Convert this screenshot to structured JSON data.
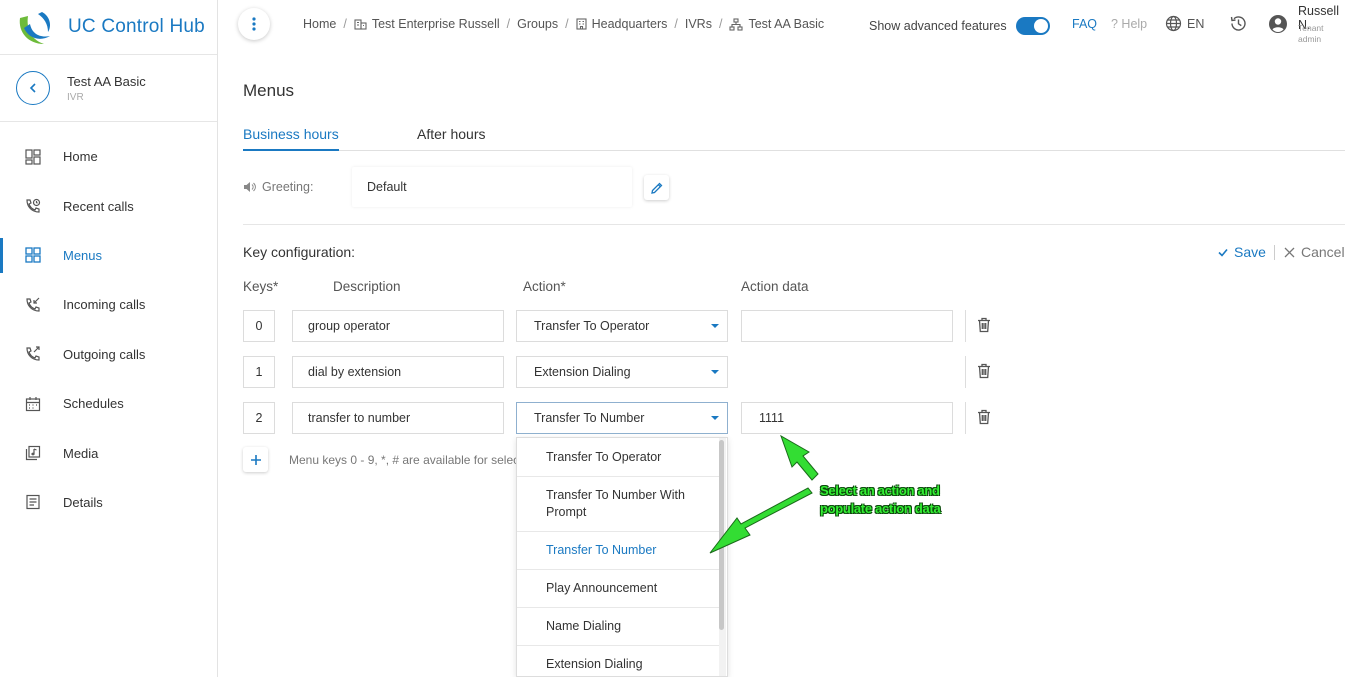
{
  "brand": {
    "name": "UC Control Hub"
  },
  "entity": {
    "title": "Test AA Basic",
    "type": "IVR"
  },
  "sidebar": {
    "items": [
      {
        "label": "Home",
        "icon": "grid-icon"
      },
      {
        "label": "Recent calls",
        "icon": "phone-clock-icon"
      },
      {
        "label": "Menus",
        "icon": "menu-grid-icon",
        "active": true
      },
      {
        "label": "Incoming calls",
        "icon": "phone-incoming-icon"
      },
      {
        "label": "Outgoing calls",
        "icon": "phone-outgoing-icon"
      },
      {
        "label": "Schedules",
        "icon": "calendar-icon"
      },
      {
        "label": "Media",
        "icon": "media-icon"
      },
      {
        "label": "Details",
        "icon": "details-icon"
      }
    ]
  },
  "breadcrumb": {
    "items": [
      "Home",
      "Test Enterprise Russell",
      "Groups",
      "Headquarters",
      "IVRs",
      "Test AA Basic"
    ]
  },
  "topbar": {
    "advanced_label": "Show advanced features",
    "advanced_on": true,
    "faq": "FAQ",
    "help": "? Help",
    "lang": "EN",
    "user_name": "Russell N.",
    "user_role_1": "Tenant",
    "user_role_2": "admin"
  },
  "page": {
    "title": "Menus",
    "tabs": [
      {
        "label": "Business hours",
        "active": true
      },
      {
        "label": "After hours",
        "active": false
      }
    ],
    "greeting_label": "Greeting:",
    "greeting_value": "Default",
    "key_config_label": "Key configuration:",
    "save_label": "Save",
    "cancel_label": "Cancel",
    "columns": {
      "keys": "Keys*",
      "description": "Description",
      "action": "Action*",
      "action_data": "Action data"
    },
    "rows": [
      {
        "key": "0",
        "description": "group operator",
        "action": "Transfer To Operator",
        "action_data": ""
      },
      {
        "key": "1",
        "description": "dial by extension",
        "action": "Extension Dialing"
      },
      {
        "key": "2",
        "description": "transfer to number",
        "action": "Transfer To Number",
        "action_data": "1111"
      }
    ],
    "hint": "Menu keys 0 - 9, *, # are available for selection"
  },
  "dropdown": {
    "options": [
      "Transfer To Operator",
      "Transfer To Number With Prompt",
      "Transfer To Number",
      "Play Announcement",
      "Name Dialing",
      "Extension Dialing"
    ],
    "selected": "Transfer To Number"
  },
  "annotation": {
    "line1": "Select an action and",
    "line2": "populate action data",
    "color": "#33ee33"
  },
  "colors": {
    "accent": "#1a79c2"
  }
}
